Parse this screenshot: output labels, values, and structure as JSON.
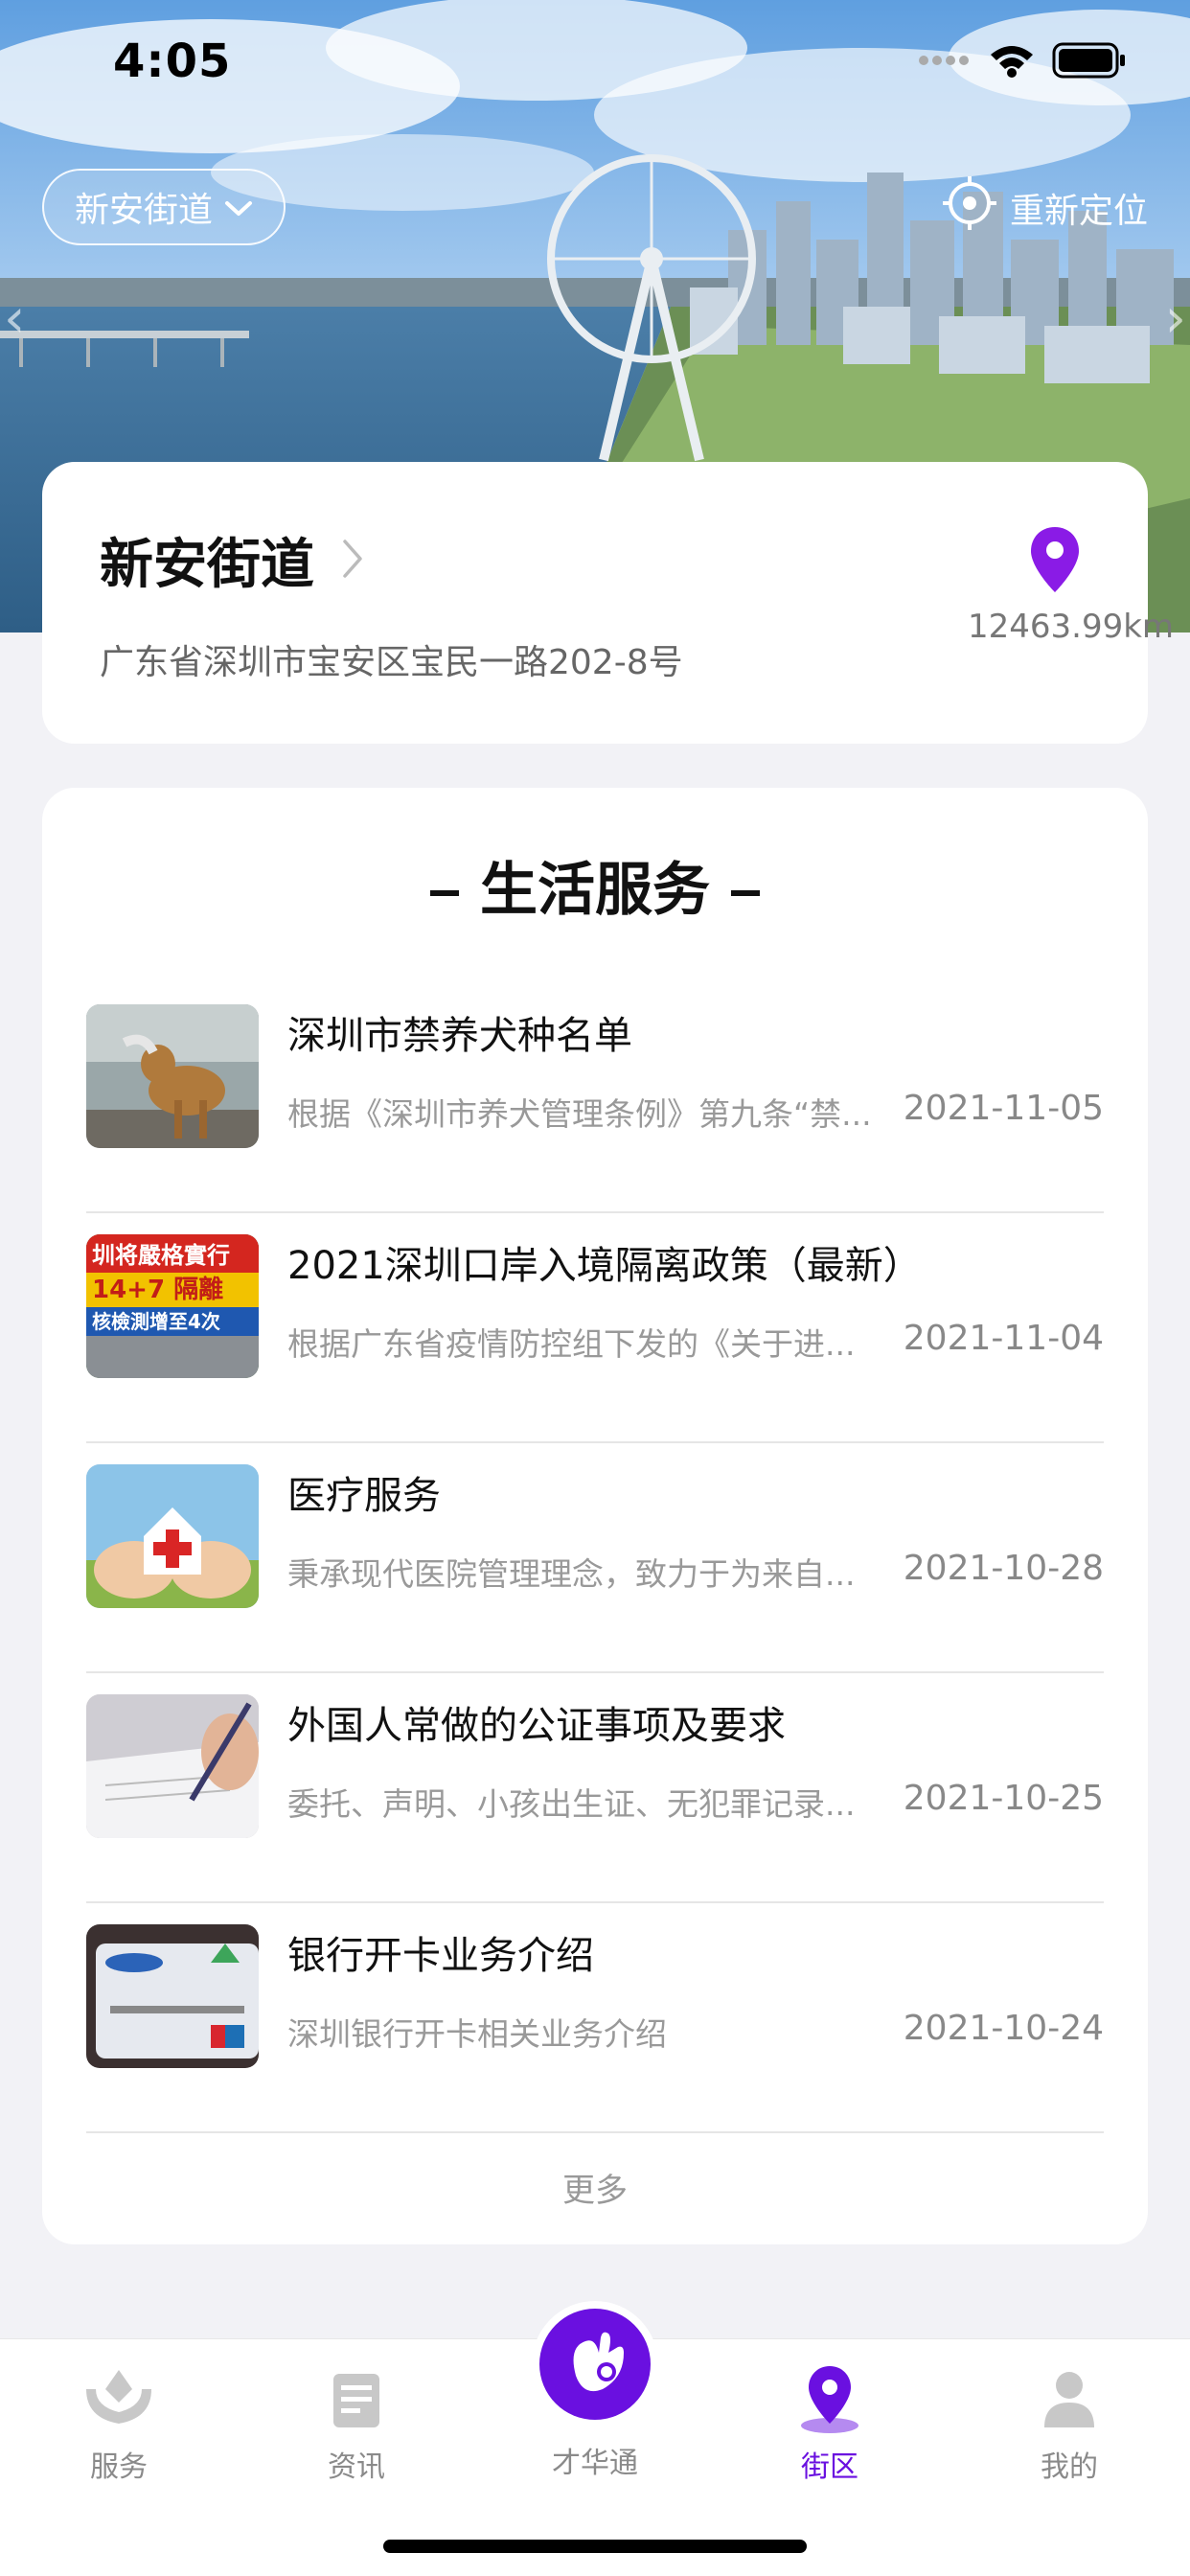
{
  "status_bar": {
    "time": "4:05"
  },
  "header": {
    "district_selector": "新安街道",
    "relocate_label": "重新定位"
  },
  "location_card": {
    "name": "新安街道",
    "address": "广东省深圳市宝安区宝民一路202-8号",
    "distance": "12463.99km"
  },
  "services": {
    "title": "生活服务",
    "items": [
      {
        "title": "深圳市禁养犬种名单",
        "summary": "根据《深圳市养犬管理条例》第九条“禁...",
        "date": "2021-11-05",
        "thumb": "dog-photo"
      },
      {
        "title": "2021深圳口岸入境隔离政策（最新）",
        "summary": "根据广东省疫情防控组下发的《关于进...",
        "date": "2021-11-04",
        "thumb": "news-poster",
        "thumb_text": "圳将嚴格實行 14+7 隔離 核檢測增至4次"
      },
      {
        "title": "医疗服务",
        "summary": "秉承现代医院管理理念，致力于为来自...",
        "date": "2021-10-28",
        "thumb": "hands-house-cross"
      },
      {
        "title": "外国人常做的公证事项及要求",
        "summary": "委托、声明、小孩出生证、无犯罪记录...",
        "date": "2021-10-25",
        "thumb": "signing-document"
      },
      {
        "title": "银行开卡业务介绍",
        "summary": "深圳银行开卡相关业务介绍",
        "date": "2021-10-24",
        "thumb": "bank-card"
      }
    ],
    "more_label": "更多"
  },
  "tab_bar": {
    "tabs": [
      {
        "label": "服务",
        "icon": "hands-icon"
      },
      {
        "label": "资讯",
        "icon": "news-icon"
      },
      {
        "label": "才华通",
        "icon": "hand-gesture-icon"
      },
      {
        "label": "街区",
        "icon": "location-pin-icon",
        "active": true
      },
      {
        "label": "我的",
        "icon": "person-icon"
      }
    ]
  },
  "colors": {
    "accent": "#6A10E0",
    "background": "#F2F2F6",
    "card": "#FFFFFF",
    "text_primary": "#111111",
    "text_secondary": "#999999"
  }
}
